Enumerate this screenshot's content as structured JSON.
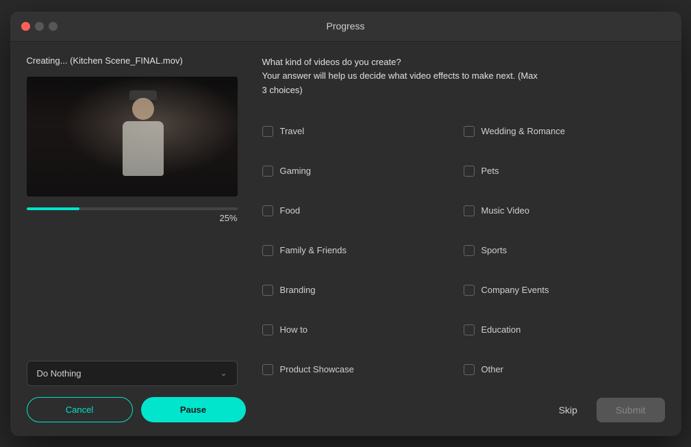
{
  "window": {
    "title": "Progress"
  },
  "left": {
    "creating_label": "Creating... (Kitchen Scene_FINAL.mov)",
    "progress_percent": "25%",
    "dropdown_value": "Do Nothing",
    "cancel_label": "Cancel",
    "pause_label": "Pause"
  },
  "right": {
    "question_line1": "What kind of videos do you create?",
    "question_line2": "Your answer will help us decide what video effects to make next.  (Max",
    "question_line3": "3 choices)",
    "checkboxes": [
      {
        "id": "travel",
        "label": "Travel",
        "checked": false
      },
      {
        "id": "wedding",
        "label": "Wedding & Romance",
        "checked": false
      },
      {
        "id": "gaming",
        "label": "Gaming",
        "checked": false
      },
      {
        "id": "pets",
        "label": "Pets",
        "checked": false
      },
      {
        "id": "food",
        "label": "Food",
        "checked": false
      },
      {
        "id": "music",
        "label": "Music Video",
        "checked": false
      },
      {
        "id": "family",
        "label": "Family & Friends",
        "checked": false
      },
      {
        "id": "sports",
        "label": "Sports",
        "checked": false
      },
      {
        "id": "branding",
        "label": "Branding",
        "checked": false
      },
      {
        "id": "company",
        "label": "Company Events",
        "checked": false
      },
      {
        "id": "howto",
        "label": "How to",
        "checked": false
      },
      {
        "id": "education",
        "label": "Education",
        "checked": false
      },
      {
        "id": "product",
        "label": "Product Showcase",
        "checked": false
      },
      {
        "id": "other",
        "label": "Other",
        "checked": false
      }
    ],
    "skip_label": "Skip",
    "submit_label": "Submit"
  }
}
